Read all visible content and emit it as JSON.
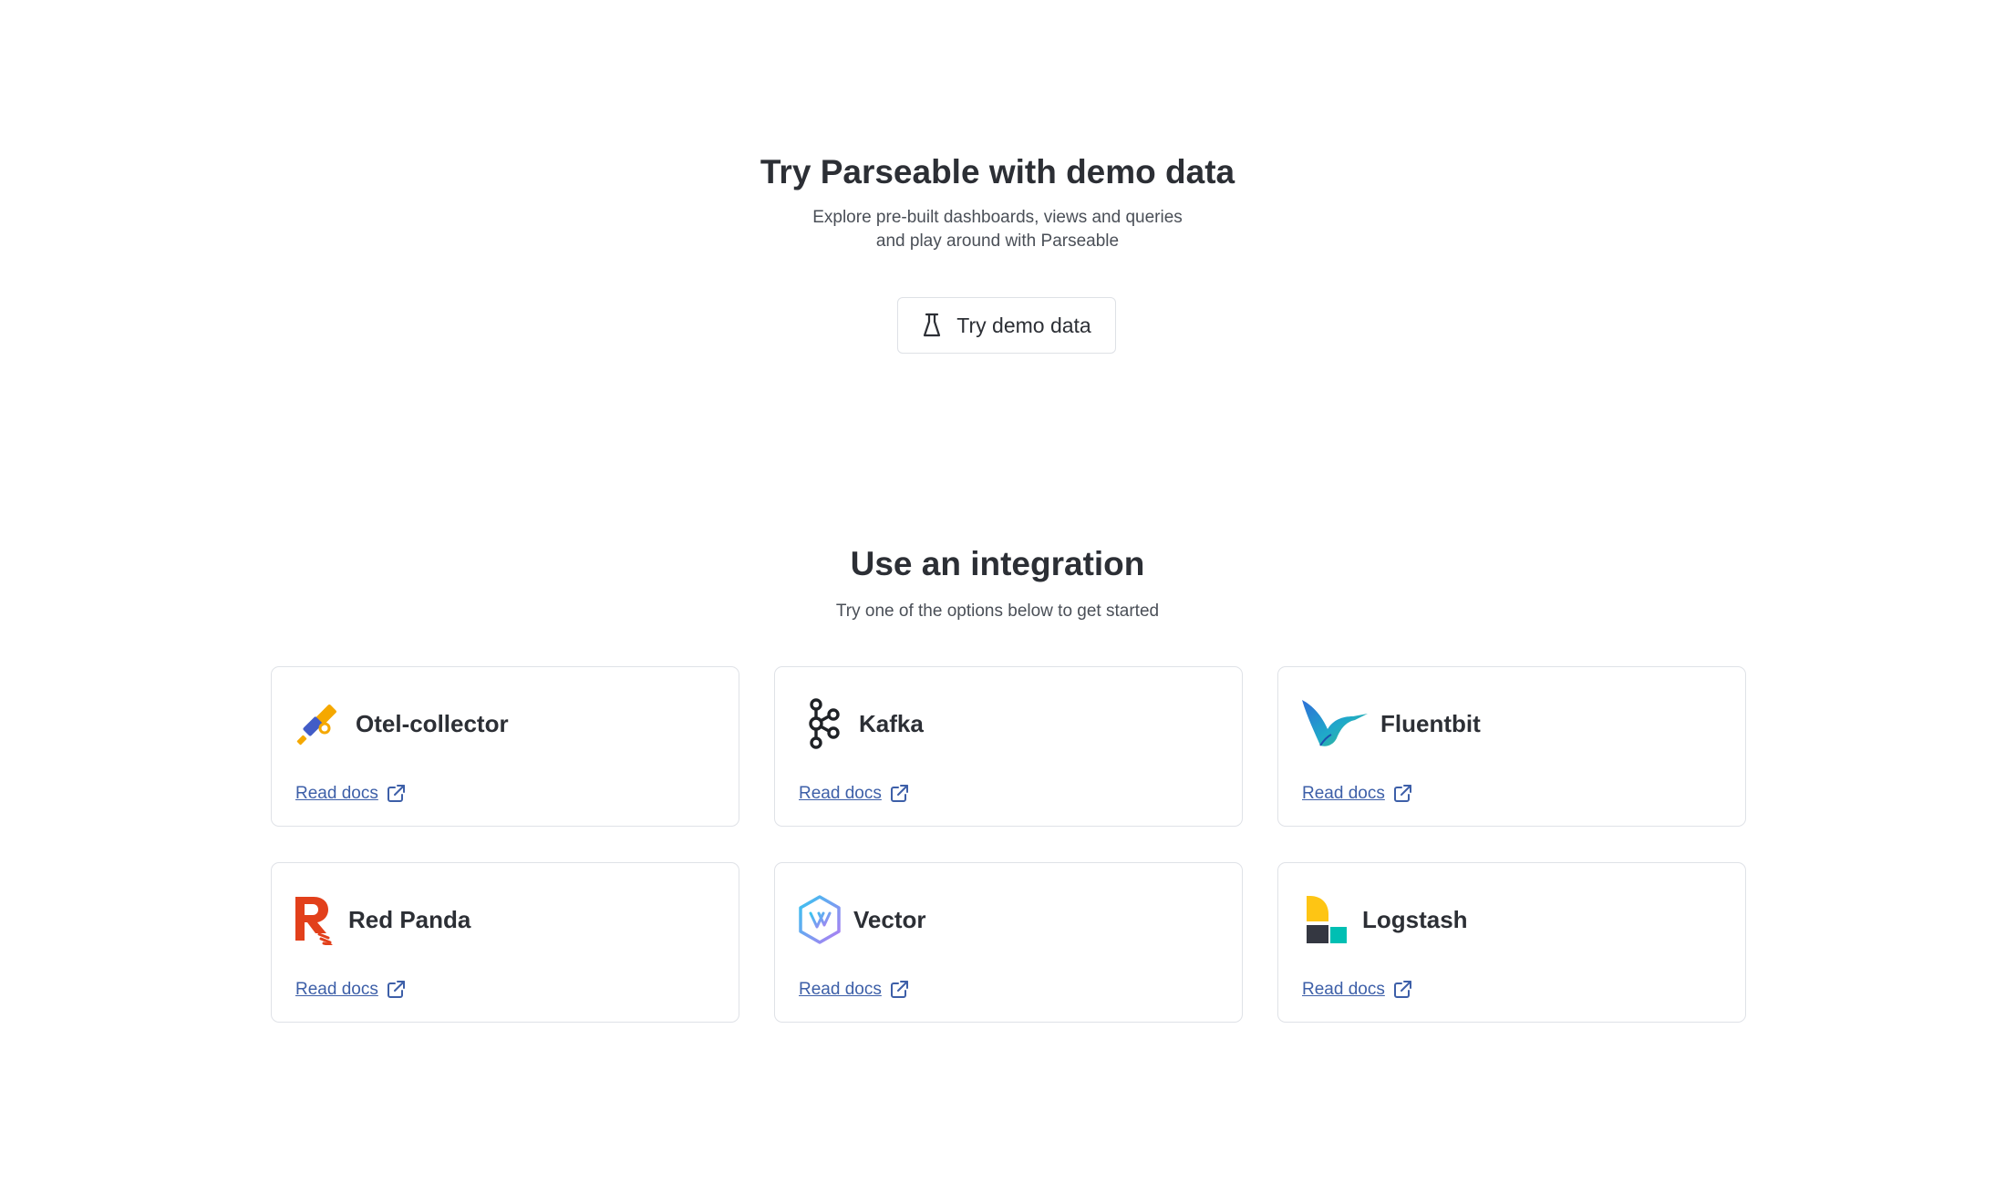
{
  "demo": {
    "title": "Try Parseable with demo data",
    "subtitle_line1": "Explore pre-built dashboards, views and queries",
    "subtitle_line2": "and play around with Parseable",
    "button_label": "Try demo data",
    "button_icon": "flask-icon"
  },
  "integration": {
    "title": "Use an integration",
    "subtitle": "Try one of the options below to get started",
    "cards": [
      {
        "name": "Otel-collector",
        "link_label": "Read docs",
        "logo": "otel-telescope-icon"
      },
      {
        "name": "Kafka",
        "link_label": "Read docs",
        "logo": "kafka-icon"
      },
      {
        "name": "Fluentbit",
        "link_label": "Read docs",
        "logo": "hummingbird-icon"
      },
      {
        "name": "Red Panda",
        "link_label": "Read docs",
        "logo": "redpanda-icon"
      },
      {
        "name": "Vector",
        "link_label": "Read docs",
        "logo": "vector-hexagon-icon"
      },
      {
        "name": "Logstash",
        "link_label": "Read docs",
        "logo": "logstash-icon"
      }
    ],
    "link_icon": "external-link-icon"
  },
  "colors": {
    "text_primary": "#2c2f35",
    "text_secondary": "#4a4f57",
    "link": "#3d5fa8",
    "border": "#dfe2e7",
    "redpanda": "#e2401b",
    "logstash_yellow": "#fec514",
    "logstash_teal": "#00bfb3",
    "otel_blue": "#425cc7",
    "otel_orange": "#f5a800"
  }
}
